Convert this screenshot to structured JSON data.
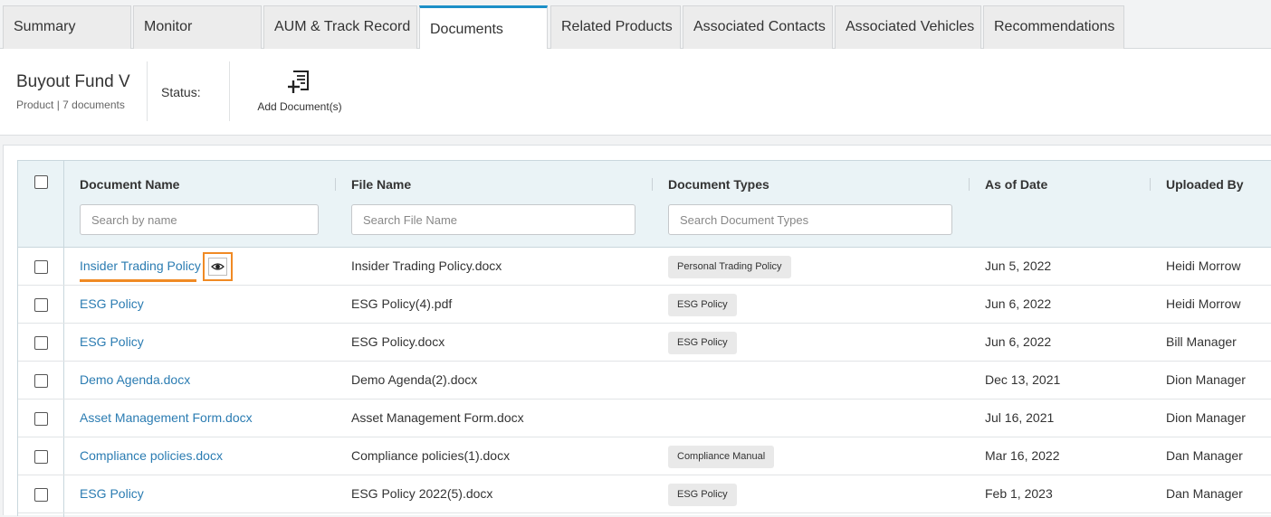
{
  "tabs": [
    {
      "label": "Summary",
      "active": false
    },
    {
      "label": "Monitor",
      "active": false
    },
    {
      "label": "AUM & Track Record",
      "active": false
    },
    {
      "label": "Documents",
      "active": true
    },
    {
      "label": "Related Products",
      "active": false
    },
    {
      "label": "Associated Contacts",
      "active": false
    },
    {
      "label": "Associated Vehicles",
      "active": false
    },
    {
      "label": "Recommendations",
      "active": false
    }
  ],
  "header": {
    "title": "Buyout Fund V",
    "subtitle": "Product | 7 documents",
    "status_label": "Status:",
    "add_document_label": "Add Document(s)",
    "add_document_icon": "add-document-icon"
  },
  "grid": {
    "columns": {
      "document_name": "Document Name",
      "file_name": "File Name",
      "document_types": "Document Types",
      "as_of_date": "As of Date",
      "uploaded_by": "Uploaded By"
    },
    "search": {
      "name_placeholder": "Search by name",
      "file_placeholder": "Search File Name",
      "types_placeholder": "Search Document Types"
    },
    "rows": [
      {
        "name": "Insider Trading Policy",
        "file": "Insider Trading Policy.docx",
        "type": "Personal Trading Policy",
        "date": "Jun 5, 2022",
        "uploader": "Heidi Morrow",
        "highlighted": true
      },
      {
        "name": "ESG Policy",
        "file": "ESG Policy(4).pdf",
        "type": "ESG Policy",
        "date": "Jun 6, 2022",
        "uploader": "Heidi Morrow"
      },
      {
        "name": "ESG Policy",
        "file": "ESG Policy.docx",
        "type": "ESG Policy",
        "date": "Jun 6, 2022",
        "uploader": "Bill Manager"
      },
      {
        "name": "Demo Agenda.docx",
        "file": "Demo Agenda(2).docx",
        "type": "",
        "date": "Dec 13, 2021",
        "uploader": "Dion Manager"
      },
      {
        "name": "Asset Management Form.docx",
        "file": "Asset Management Form.docx",
        "type": "",
        "date": "Jul 16, 2021",
        "uploader": "Dion Manager"
      },
      {
        "name": "Compliance policies.docx",
        "file": "Compliance policies(1).docx",
        "type": "Compliance Manual",
        "date": "Mar 16, 2022",
        "uploader": "Dan Manager"
      },
      {
        "name": "ESG Policy",
        "file": "ESG Policy 2022(5).docx",
        "type": "ESG Policy",
        "date": "Feb 1, 2023",
        "uploader": "Dan Manager"
      }
    ]
  },
  "colors": {
    "accent_tab": "#1b8fc7",
    "link": "#2b7cb2",
    "highlight": "#f08a24",
    "header_bg": "#eaf3f6"
  }
}
